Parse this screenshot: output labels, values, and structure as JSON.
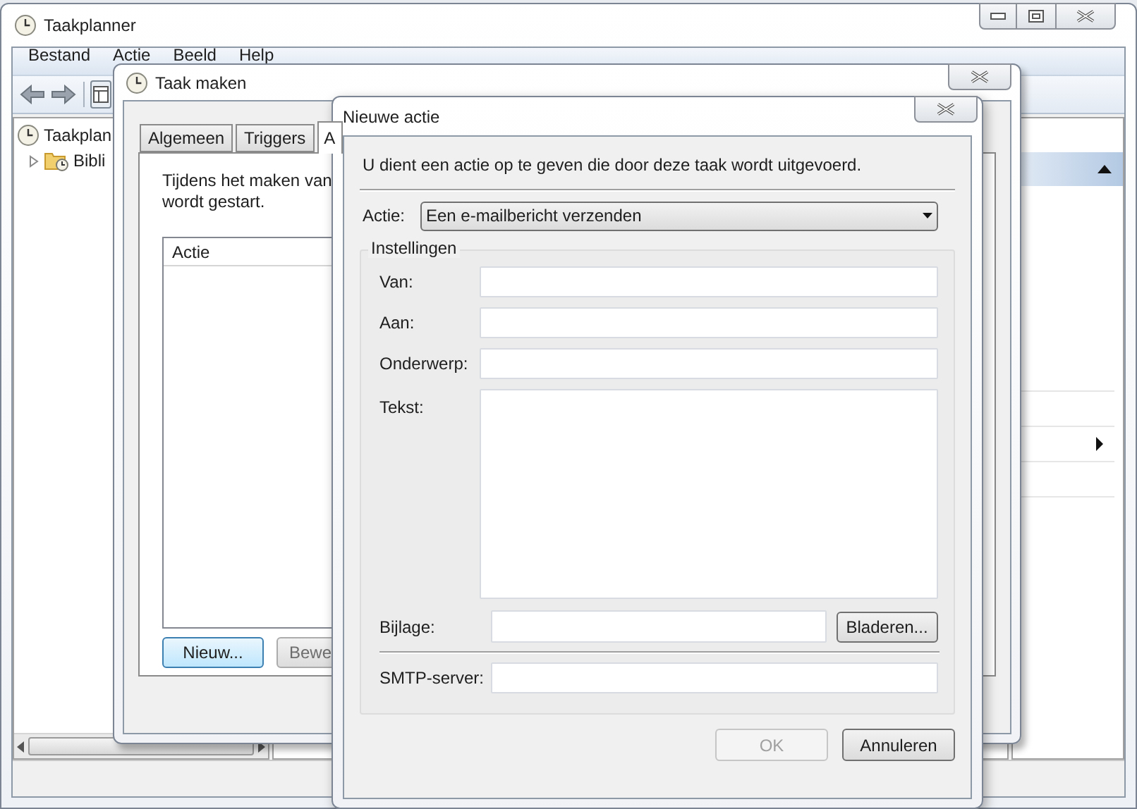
{
  "main_window": {
    "title": "Taakplanner",
    "menu": [
      {
        "label": "Bestand"
      },
      {
        "label": "Actie"
      },
      {
        "label": "Beeld"
      },
      {
        "label": "Help"
      }
    ],
    "tree": [
      {
        "label": "Taakplan",
        "children": [
          {
            "label": "Bibli",
            "expanded": false
          }
        ]
      }
    ]
  },
  "task_dialog": {
    "title": "Taak maken",
    "tabs": [
      {
        "label": "Algemeen",
        "selected": false
      },
      {
        "label": "Triggers",
        "selected": false
      },
      {
        "label": "A",
        "selected": true
      }
    ],
    "description_lines": [
      "Tijdens het maken van",
      "wordt gestart."
    ],
    "list_columns": [
      "Actie"
    ],
    "buttons": [
      {
        "label": "Nieuw...",
        "default": true
      },
      {
        "label": "Bewe",
        "default": false
      }
    ]
  },
  "action_dialog": {
    "title": "Nieuwe actie",
    "instruction": "U dient een actie op te geven die door deze taak wordt uitgevoerd.",
    "action_label": "Actie:",
    "action_value": "Een e-mailbericht verzenden",
    "group_title": "Instellingen",
    "fields": [
      {
        "label": "Van:",
        "kind": "text"
      },
      {
        "label": "Aan:",
        "kind": "text"
      },
      {
        "label": "Onderwerp:",
        "kind": "text"
      },
      {
        "label": "Tekst:",
        "kind": "multiline"
      },
      {
        "label": "Bijlage:",
        "kind": "file",
        "button": "Bladeren..."
      },
      {
        "label": "SMTP-server:",
        "kind": "separated"
      }
    ],
    "buttons": [
      {
        "label": "OK",
        "disabled": true
      },
      {
        "label": "Annuleren",
        "disabled": false
      }
    ]
  }
}
